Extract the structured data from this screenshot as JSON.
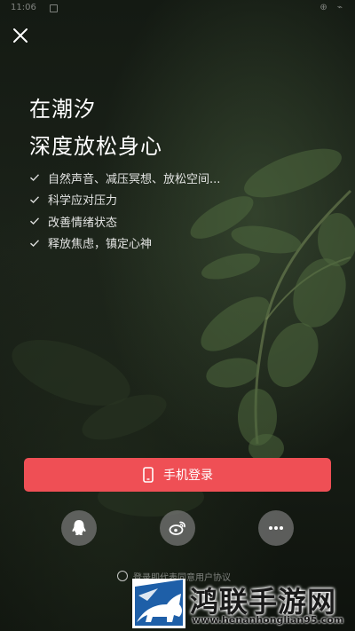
{
  "status_bar": {
    "time": "11:06",
    "right_icons": "⊕ ⌁"
  },
  "close": {
    "icon": "close-icon"
  },
  "headline": {
    "line1": "在潮汐",
    "line2": "深度放松身心"
  },
  "features": [
    {
      "icon": "check-icon",
      "text": "自然声音、减压冥想、放松空间..."
    },
    {
      "icon": "check-icon",
      "text": "科学应对压力"
    },
    {
      "icon": "check-icon",
      "text": "改善情绪状态"
    },
    {
      "icon": "check-icon",
      "text": "释放焦虑，镇定心神"
    }
  ],
  "login": {
    "label": "手机登录",
    "icon": "phone-icon",
    "color": "#ef4f55"
  },
  "social_buttons": [
    {
      "name": "qq",
      "icon": "qq-icon"
    },
    {
      "name": "weibo",
      "icon": "weibo-icon"
    },
    {
      "name": "more",
      "icon": "more-icon"
    }
  ],
  "agreement": {
    "text": "登录即代表同意用户协议"
  },
  "watermark": {
    "title": "鸿联手游网",
    "url": "www.henanhonglian95.com"
  }
}
